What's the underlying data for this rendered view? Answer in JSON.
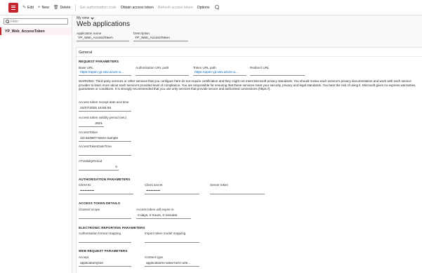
{
  "toolbar": {
    "edit": "Edit",
    "new": "New",
    "delete": "Delete",
    "get_auth_code": "Get authorisation code",
    "obtain_token": "Obtain access token",
    "refresh_token": "Refresh access token",
    "options": "Options"
  },
  "left": {
    "filter_placeholder": "Filter",
    "items": [
      "YP_Web_AccessToken"
    ]
  },
  "header": {
    "view": "My view",
    "title": "Web applications"
  },
  "top_fields": {
    "app_name_label": "Application name",
    "app_name": "YP_Web_AccessToken",
    "desc_label": "Description",
    "desc": "YP_Web_AccessToken"
  },
  "general": {
    "title": "General",
    "request_params": "REQUEST PARAMETERS",
    "base_url_label": "Base URL",
    "base_url": "https://apim-yp-dev.azure-a...",
    "auth_url_path_label": "Authorisation URL path",
    "auth_url_path": "",
    "token_url_path_label": "Token URL path",
    "token_url_path": "https://apim-yp-dev.azure-a...",
    "redirect_url_label": "Redirect URL",
    "redirect_url": "",
    "warning": "WARNING: Third-party services or other services that you configure here do not require certification and they might not meet Microsoft privacy standards. You should review each service's privacy documentation and work with each service provider to learn more about each service's provided level of compliance. You are responsible for ensuring that these services meet your security, privacy and legal standards. You bear the risk of using it. Microsoft gives no express warranties, guarantees or conditions. It is strongly recommended that you use only services that provide secure and authorised connections (https://).",
    "receipt_label": "Access token receipt date and time",
    "receipt": "22/07/2025 16:55:08",
    "validity_label": "Access token validity period (sec)",
    "validity": "2521",
    "access_token_label": "AccessToken",
    "access_token": "12c3d4567-token-sample",
    "access_token_dt_label": "AccessTokenDateTime",
    "access_token_dt": "",
    "at_validity_label": "ATValidityPeriod",
    "at_validity": "0"
  },
  "auth": {
    "title": "AUTHORISATION PARAMETERS",
    "client_id_label": "Client ID",
    "client_id": "••••••••••••",
    "client_secret_label": "Client secret",
    "client_secret": "••••••••••••",
    "server_token_label": "Server token",
    "server_token": ""
  },
  "token_details": {
    "title": "ACCESS TOKEN DETAILS",
    "granted_scope_label": "Granted scope",
    "granted_scope": "",
    "expire_label": "Access token will expire in",
    "expire": "0 days, 0 hours, 0 minutes"
  },
  "er": {
    "title": "ELECTRONIC REPORTING PARAMETERS",
    "auth_format_label": "Authorisation format mapping",
    "auth_format": "",
    "import_token_label": "Import token model mapping",
    "import_token": ""
  },
  "web_request": {
    "title": "WEB REQUEST PARAMETERS",
    "accept_label": "Accept",
    "accept": "application/json",
    "content_type_label": "Content type",
    "content_type": "application/x-www-form-urle..."
  }
}
